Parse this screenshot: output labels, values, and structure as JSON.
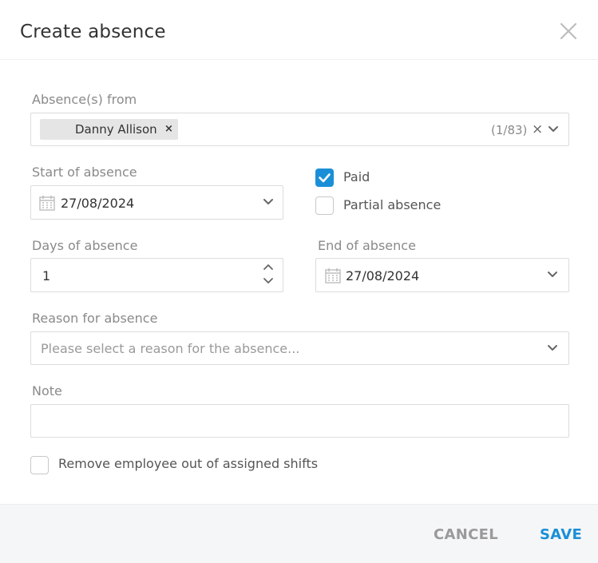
{
  "dialog": {
    "title": "Create absence",
    "close_icon": "close-icon"
  },
  "absences_from": {
    "label": "Absence(s) from",
    "selected_tag": "Danny Allison",
    "tag_remove": "×",
    "count": "(1/83)",
    "clear": "×"
  },
  "start_of_absence": {
    "label": "Start of absence",
    "value": "27/08/2024"
  },
  "paid": {
    "label": "Paid",
    "checked": true
  },
  "partial_absence": {
    "label": "Partial absence",
    "checked": false
  },
  "days_of_absence": {
    "label": "Days of absence",
    "value": "1"
  },
  "end_of_absence": {
    "label": "End of absence",
    "value": "27/08/2024"
  },
  "reason": {
    "label": "Reason for absence",
    "placeholder": "Please select a reason for the absence..."
  },
  "note": {
    "label": "Note",
    "value": ""
  },
  "remove_from_shifts": {
    "label": "Remove employee out of assigned shifts",
    "checked": false
  },
  "footer": {
    "cancel_label": "CANCEL",
    "save_label": "SAVE"
  },
  "colors": {
    "accent": "#1a8fd8",
    "muted": "#9a9a9a"
  }
}
